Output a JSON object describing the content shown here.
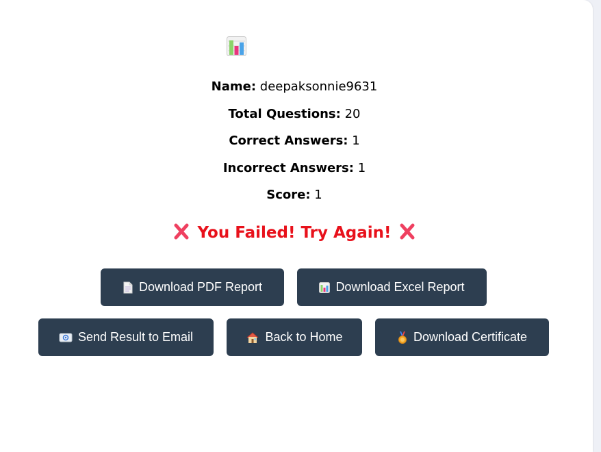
{
  "icons": {
    "header": "bar-chart-icon",
    "fail": "cross-mark-icon"
  },
  "stats": {
    "name_label": "Name:",
    "name_value": "deepaksonnie9631",
    "total_label": "Total Questions:",
    "total_value": "20",
    "correct_label": "Correct Answers:",
    "correct_value": "1",
    "incorrect_label": "Incorrect Answers:",
    "incorrect_value": "1",
    "score_label": "Score:",
    "score_value": "1"
  },
  "result": {
    "message": "You Failed! Try Again!",
    "color": "#e8111b"
  },
  "buttons": {
    "pdf": {
      "label": "Download PDF Report",
      "icon": "page-icon"
    },
    "excel": {
      "label": "Download Excel Report",
      "icon": "bar-chart-icon"
    },
    "email": {
      "label": "Send Result to Email",
      "icon": "email-icon"
    },
    "home": {
      "label": "Back to Home",
      "icon": "house-icon"
    },
    "certificate": {
      "label": "Download Certificate",
      "icon": "medal-icon"
    }
  },
  "colors": {
    "button_bg": "#2d3e50",
    "page_bg": "#eef0f6",
    "card_bg": "#ffffff"
  }
}
